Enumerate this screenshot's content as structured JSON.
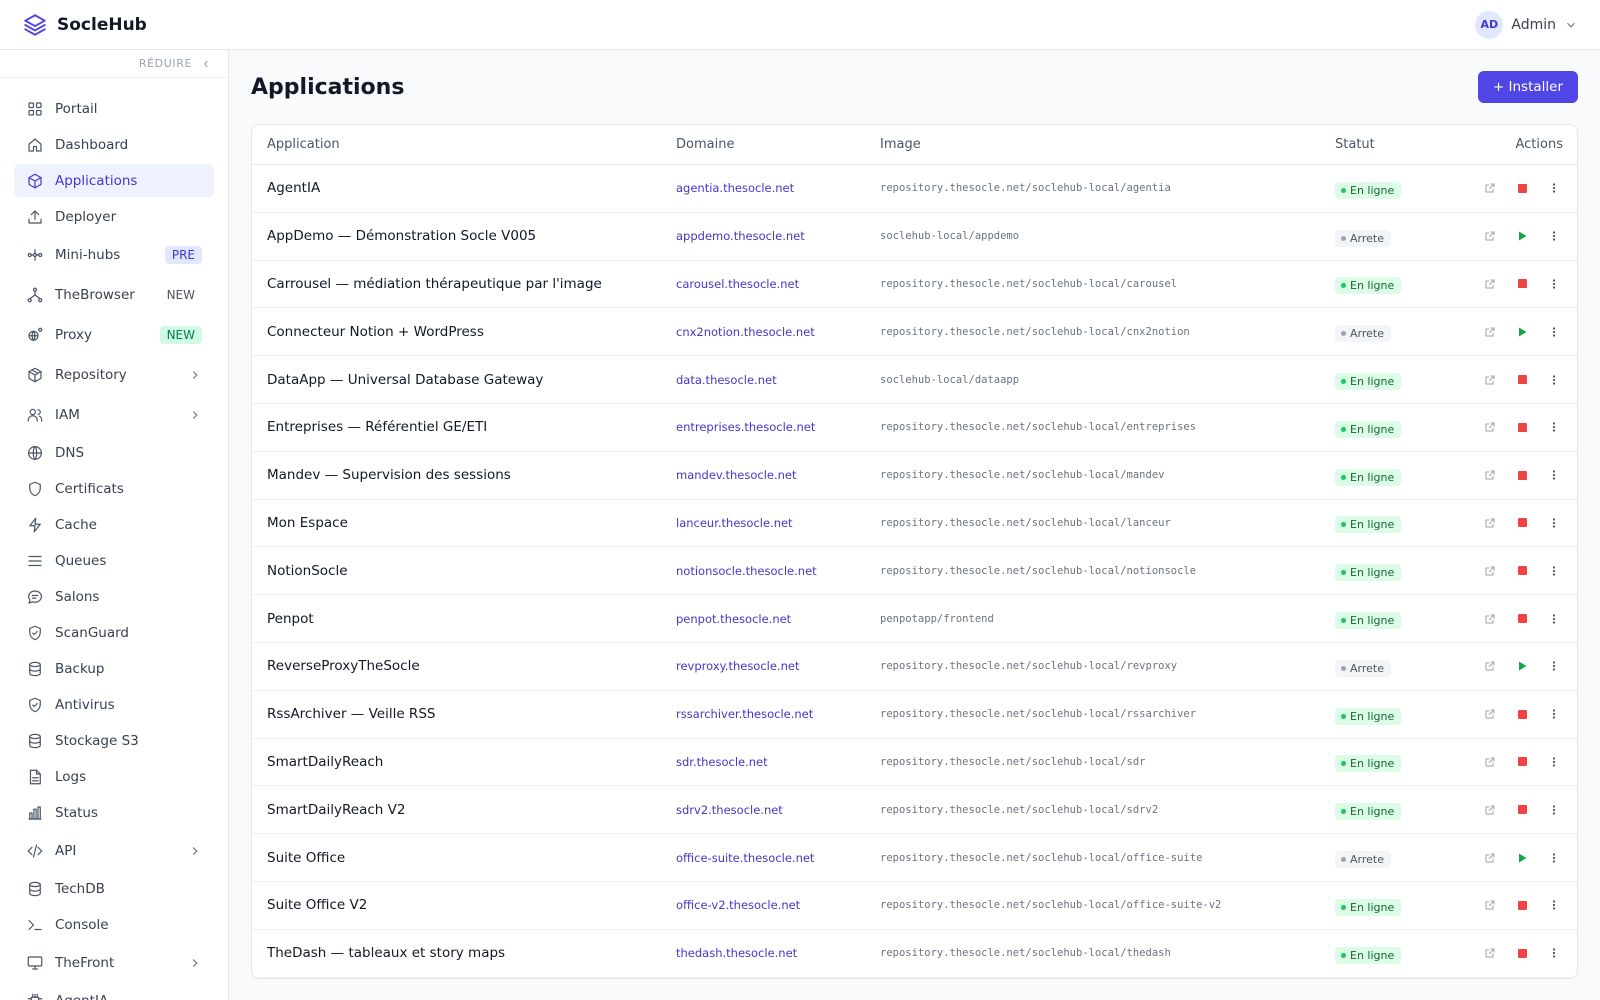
{
  "app": {
    "name": "SocleHub"
  },
  "user": {
    "initials": "AD",
    "name": "Admin"
  },
  "sidebar": {
    "collapse_label": "RÉDUIRE",
    "items": [
      {
        "label": "Portail",
        "icon": "grid-icon"
      },
      {
        "label": "Dashboard",
        "icon": "home-icon"
      },
      {
        "label": "Applications",
        "icon": "cube-icon",
        "active": true
      },
      {
        "label": "Deployer",
        "icon": "upload-icon"
      },
      {
        "label": "Mini-hubs",
        "icon": "hub-icon",
        "badge": "PRE"
      },
      {
        "label": "TheBrowser",
        "icon": "fork-icon",
        "badge": "NEW"
      },
      {
        "label": "Proxy",
        "icon": "proxy-icon",
        "badge": "NEW"
      },
      {
        "label": "Repository",
        "icon": "package-icon",
        "chevron": true
      },
      {
        "label": "IAM",
        "icon": "users-icon",
        "chevron": true
      },
      {
        "label": "DNS",
        "icon": "globe-icon"
      },
      {
        "label": "Certificats",
        "icon": "shield-icon"
      },
      {
        "label": "Cache",
        "icon": "bolt-icon"
      },
      {
        "label": "Queues",
        "icon": "list-icon"
      },
      {
        "label": "Salons",
        "icon": "chat-icon"
      },
      {
        "label": "ScanGuard",
        "icon": "shield-check-icon"
      },
      {
        "label": "Backup",
        "icon": "database-icon"
      },
      {
        "label": "Antivirus",
        "icon": "shield-check-icon"
      },
      {
        "label": "Stockage S3",
        "icon": "database-icon"
      },
      {
        "label": "Logs",
        "icon": "file-icon"
      },
      {
        "label": "Status",
        "icon": "bar-chart-icon"
      },
      {
        "label": "API",
        "icon": "code-icon",
        "chevron": true
      },
      {
        "label": "TechDB",
        "icon": "database-icon"
      },
      {
        "label": "Console",
        "icon": "terminal-icon"
      },
      {
        "label": "TheFront",
        "icon": "monitor-icon",
        "chevron": true
      },
      {
        "label": "AgentIA",
        "icon": "cpu-icon"
      }
    ]
  },
  "main": {
    "title": "Applications",
    "install_label": "+ Installer",
    "columns": {
      "app": "Application",
      "domain": "Domaine",
      "image": "Image",
      "status": "Statut",
      "actions": "Actions"
    },
    "rows": [
      {
        "app": "AgentIA",
        "domain": "agentia.thesocle.net",
        "image": "repository.thesocle.net/soclehub-local/agentia",
        "status": "En ligne",
        "running": true
      },
      {
        "app": "AppDemo — Démonstration Socle V005",
        "domain": "appdemo.thesocle.net",
        "image": "soclehub-local/appdemo",
        "status": "Arrete",
        "running": false
      },
      {
        "app": "Carrousel — médiation thérapeutique par l'image",
        "domain": "carousel.thesocle.net",
        "image": "repository.thesocle.net/soclehub-local/carousel",
        "status": "En ligne",
        "running": true
      },
      {
        "app": "Connecteur Notion + WordPress",
        "domain": "cnx2notion.thesocle.net",
        "image": "repository.thesocle.net/soclehub-local/cnx2notion",
        "status": "Arrete",
        "running": false
      },
      {
        "app": "DataApp — Universal Database Gateway",
        "domain": "data.thesocle.net",
        "image": "soclehub-local/dataapp",
        "status": "En ligne",
        "running": true
      },
      {
        "app": "Entreprises — Référentiel GE/ETI",
        "domain": "entreprises.thesocle.net",
        "image": "repository.thesocle.net/soclehub-local/entreprises",
        "status": "En ligne",
        "running": true
      },
      {
        "app": "Mandev — Supervision des sessions",
        "domain": "mandev.thesocle.net",
        "image": "repository.thesocle.net/soclehub-local/mandev",
        "status": "En ligne",
        "running": true
      },
      {
        "app": "Mon Espace",
        "domain": "lanceur.thesocle.net",
        "image": "repository.thesocle.net/soclehub-local/lanceur",
        "status": "En ligne",
        "running": true
      },
      {
        "app": "NotionSocle",
        "domain": "notionsocle.thesocle.net",
        "image": "repository.thesocle.net/soclehub-local/notionsocle",
        "status": "En ligne",
        "running": true
      },
      {
        "app": "Penpot",
        "domain": "penpot.thesocle.net",
        "image": "penpotapp/frontend",
        "status": "En ligne",
        "running": true
      },
      {
        "app": "ReverseProxyTheSocle",
        "domain": "revproxy.thesocle.net",
        "image": "repository.thesocle.net/soclehub-local/revproxy",
        "status": "Arrete",
        "running": false
      },
      {
        "app": "RssArchiver — Veille RSS",
        "domain": "rssarchiver.thesocle.net",
        "image": "repository.thesocle.net/soclehub-local/rssarchiver",
        "status": "En ligne",
        "running": true
      },
      {
        "app": "SmartDailyReach",
        "domain": "sdr.thesocle.net",
        "image": "repository.thesocle.net/soclehub-local/sdr",
        "status": "En ligne",
        "running": true
      },
      {
        "app": "SmartDailyReach V2",
        "domain": "sdrv2.thesocle.net",
        "image": "repository.thesocle.net/soclehub-local/sdrv2",
        "status": "En ligne",
        "running": true
      },
      {
        "app": "Suite Office",
        "domain": "office-suite.thesocle.net",
        "image": "repository.thesocle.net/soclehub-local/office-suite",
        "status": "Arrete",
        "running": false
      },
      {
        "app": "Suite Office V2",
        "domain": "office-v2.thesocle.net",
        "image": "repository.thesocle.net/soclehub-local/office-suite-v2",
        "status": "En ligne",
        "running": true
      },
      {
        "app": "TheDash — tableaux et story maps",
        "domain": "thedash.thesocle.net",
        "image": "repository.thesocle.net/soclehub-local/thedash",
        "status": "En ligne",
        "running": true
      }
    ]
  }
}
